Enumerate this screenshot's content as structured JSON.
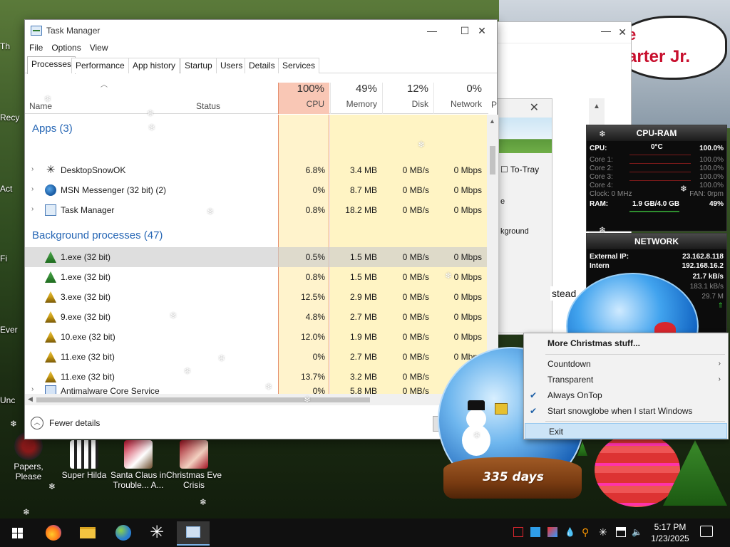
{
  "colors": {
    "cpu_header": "#f9c7b5",
    "cpu_cell": "#fff3cc",
    "heat": "#fff4c4",
    "section": "#2767b5",
    "menu_hover": "#cce4f7",
    "gadget_bg": "#0c0c0c"
  },
  "desktop": {
    "icons": [
      {
        "label": "Papers, Please",
        "icon": "papers-please-icon"
      },
      {
        "label": "Super Hilda",
        "icon": "super-hilda-icon"
      },
      {
        "label": "Santa Claus in Trouble... A...",
        "icon": "santa-claus-icon"
      },
      {
        "label": "Christmas Eve Crisis",
        "icon": "christmas-eve-crisis-icon"
      }
    ],
    "clipped_labels": [
      "Th",
      "Recy",
      "Act",
      "Fi",
      "Ever",
      "Unc"
    ],
    "banner_e": "e",
    "banner_text": "arter Jr."
  },
  "background_window": {
    "to_tray": "To-Tray",
    "background_text": "kground",
    "e_text": "e",
    "instead_text": "stead"
  },
  "task_manager": {
    "title": "Task Manager",
    "menu": [
      "File",
      "Options",
      "View"
    ],
    "tabs": [
      "Processes",
      "Performance",
      "App history",
      "Startup",
      "Users",
      "Details",
      "Services"
    ],
    "columns": {
      "name": "Name",
      "status": "Status",
      "cpu": {
        "pct": "100%",
        "label": "CPU"
      },
      "memory": {
        "pct": "49%",
        "label": "Memory"
      },
      "disk": {
        "pct": "12%",
        "label": "Disk"
      },
      "network": {
        "pct": "0%",
        "label": "Network"
      },
      "power": "P"
    },
    "apps_heading": "Apps (3)",
    "background_heading": "Background processes (47)",
    "apps": [
      {
        "name": "DesktopSnowOK",
        "icon": "snowflake-icon",
        "cpu": "6.8%",
        "memory": "3.4 MB",
        "disk": "0 MB/s",
        "network": "0 Mbps"
      },
      {
        "name": "MSN Messenger (32 bit) (2)",
        "icon": "msn-messenger-icon",
        "cpu": "0%",
        "memory": "8.7 MB",
        "disk": "0 MB/s",
        "network": "0 Mbps"
      },
      {
        "name": "Task Manager",
        "icon": "task-manager-icon",
        "cpu": "0.8%",
        "memory": "18.2 MB",
        "disk": "0 MB/s",
        "network": "0 Mbps"
      }
    ],
    "background": [
      {
        "name": "1.exe (32 bit)",
        "icon": "tree-icon",
        "cpu": "0.5%",
        "memory": "1.5 MB",
        "disk": "0 MB/s",
        "network": "0 Mbps"
      },
      {
        "name": "1.exe (32 bit)",
        "icon": "tree-icon",
        "cpu": "0.8%",
        "memory": "1.5 MB",
        "disk": "0 MB/s",
        "network": "0 Mbps"
      },
      {
        "name": "3.exe (32 bit)",
        "icon": "tree-icon",
        "cpu": "12.5%",
        "memory": "2.9 MB",
        "disk": "0 MB/s",
        "network": "0 Mbps"
      },
      {
        "name": "9.exe (32 bit)",
        "icon": "tree-icon",
        "cpu": "4.8%",
        "memory": "2.7 MB",
        "disk": "0 MB/s",
        "network": "0 Mbps"
      },
      {
        "name": "10.exe (32 bit)",
        "icon": "tree-icon",
        "cpu": "12.0%",
        "memory": "1.9 MB",
        "disk": "0 MB/s",
        "network": "0 Mbps"
      },
      {
        "name": "11.exe (32 bit)",
        "icon": "tree-icon",
        "cpu": "0%",
        "memory": "2.7 MB",
        "disk": "0 MB/s",
        "network": "0 Mbps"
      },
      {
        "name": "11.exe (32 bit)",
        "icon": "tree-icon",
        "cpu": "13.7%",
        "memory": "3.2 MB",
        "disk": "0 MB/s",
        "network": "0 Mb"
      },
      {
        "name": "Antimalware Core Service",
        "icon": "service-icon",
        "cpu": "0%",
        "memory": "5.8 MB",
        "disk": "0 MB/s",
        "network": ""
      }
    ],
    "fewer_details": "Fewer details"
  },
  "cpu_ram_gadget": {
    "title": "CPU-RAM",
    "cpu_label": "CPU:",
    "cpu_temp": "0°C",
    "cpu_pct": "100.0%",
    "cores": [
      {
        "label": "Core 1:",
        "value": "100.0%"
      },
      {
        "label": "Core 2:",
        "value": "100.0%"
      },
      {
        "label": "Core 3:",
        "value": "100.0%"
      },
      {
        "label": "Core 4:",
        "value": "100.0%"
      }
    ],
    "clock": "Clock: 0 MHz",
    "fan": "FAN: 0rpm",
    "ram_label": "RAM:",
    "ram_value": "1.9 GB/4.0 GB",
    "ram_pct": "49%"
  },
  "network_gadget": {
    "title": "NETWORK",
    "external_label": "External IP:",
    "external_ip": "23.162.8.118",
    "internal_label": "Intern",
    "internal_ip": "192.168.16.2",
    "speed1": "21.7 kB/s",
    "speed2": "183.1 kB/s",
    "speed3": "29.7 M"
  },
  "context_menu": {
    "items": [
      {
        "label": "More Christmas stuff...",
        "bold": true,
        "checked": false,
        "submenu": false
      },
      {
        "label": "Countdown",
        "bold": false,
        "checked": false,
        "submenu": true
      },
      {
        "label": "Transparent",
        "bold": false,
        "checked": false,
        "submenu": true
      },
      {
        "label": "Always OnTop",
        "bold": false,
        "checked": true,
        "submenu": false
      },
      {
        "label": "Start snowglobe when I start Windows",
        "bold": false,
        "checked": true,
        "submenu": false
      },
      {
        "label": "Exit",
        "bold": false,
        "checked": false,
        "submenu": false,
        "hovered": true
      }
    ]
  },
  "snowglobe": {
    "days": "335 days"
  },
  "taskbar": {
    "apps": [
      "firefox-icon",
      "file-explorer-icon",
      "msn-messenger-icon",
      "snowflake-icon",
      "task-manager-icon"
    ],
    "time": "5:17 PM",
    "date": "1/23/2025"
  }
}
